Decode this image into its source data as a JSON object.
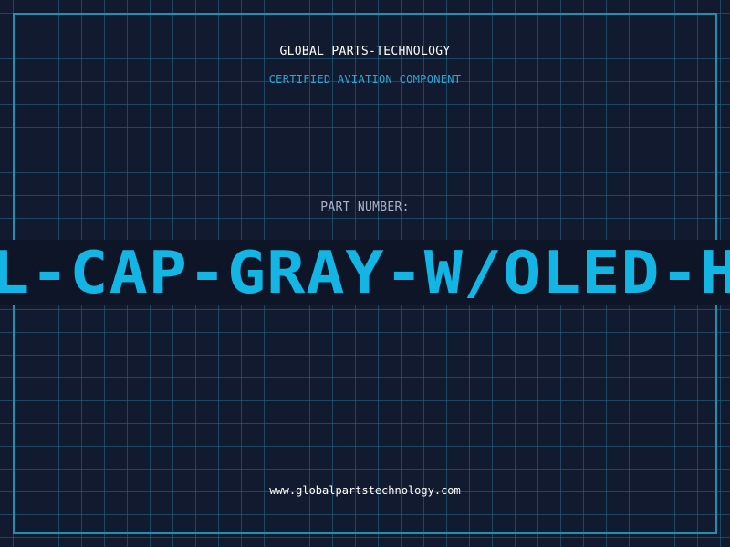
{
  "header": {
    "company": "GLOBAL PARTS-TECHNOLOGY",
    "tagline": "CERTIFIED AVIATION COMPONENT"
  },
  "part": {
    "label": "PART NUMBER:",
    "visible_number": "L-CAP-GRAY-W/OLED-H"
  },
  "footer": {
    "website": "www.globalpartstechnology.com"
  },
  "colors": {
    "background": "#111a2e",
    "grid": "#1e6e8c",
    "accent": "#12b5e3",
    "text": "#ffffff",
    "muted": "#a9b4c6"
  }
}
